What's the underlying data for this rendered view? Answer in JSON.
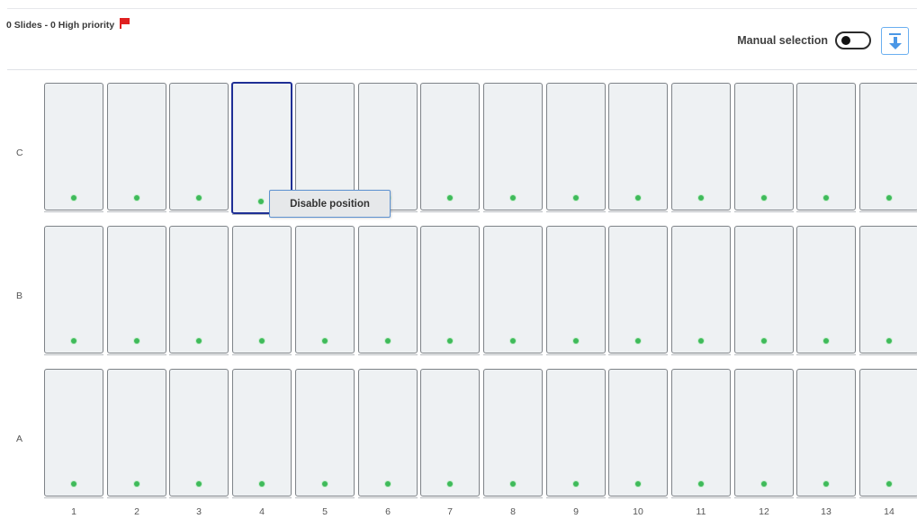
{
  "header": {
    "summary": "0 Slides - 0 High priority",
    "flag_icon": "red-flag-icon",
    "manual_selection_label": "Manual selection",
    "manual_selection_on": false,
    "download_icon": "download-icon"
  },
  "colors": {
    "accent": "#4a97e6",
    "selected_border": "#1f2f95",
    "status_dot": "#3fba5a",
    "flag": "#e02020",
    "cell_bg": "#eef1f3"
  },
  "grid": {
    "rows": [
      "C",
      "B",
      "A"
    ],
    "columns": [
      "1",
      "2",
      "3",
      "4",
      "5",
      "6",
      "7",
      "8",
      "9",
      "10",
      "11",
      "12",
      "13",
      "14"
    ],
    "selected_cell": {
      "row": "C",
      "column": "4"
    }
  },
  "context_menu": {
    "items": [
      {
        "label": "Disable position"
      }
    ]
  }
}
